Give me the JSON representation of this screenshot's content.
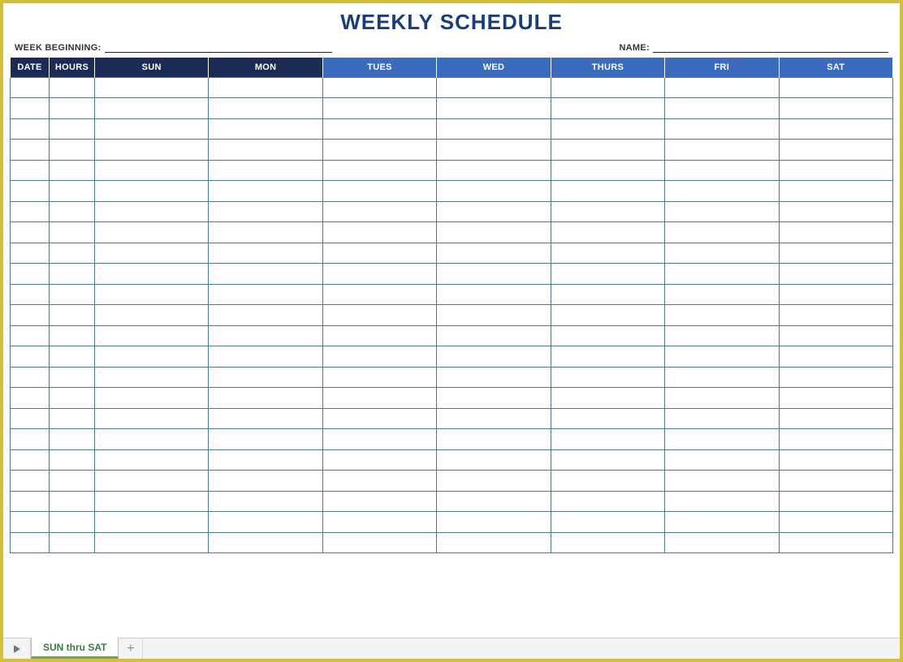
{
  "title": "WEEKLY SCHEDULE",
  "meta": {
    "weekBeginningLabel": "WEEK BEGINNING:",
    "weekBeginningValue": "",
    "nameLabel": "NAME:",
    "nameValue": ""
  },
  "headers": {
    "date": "DATE",
    "hours": "HOURS",
    "days": [
      "SUN",
      "MON",
      "TUES",
      "WED",
      "THURS",
      "FRI",
      "SAT"
    ]
  },
  "bodyRowCount": 23,
  "tabs": {
    "active": "SUN thru SAT"
  }
}
